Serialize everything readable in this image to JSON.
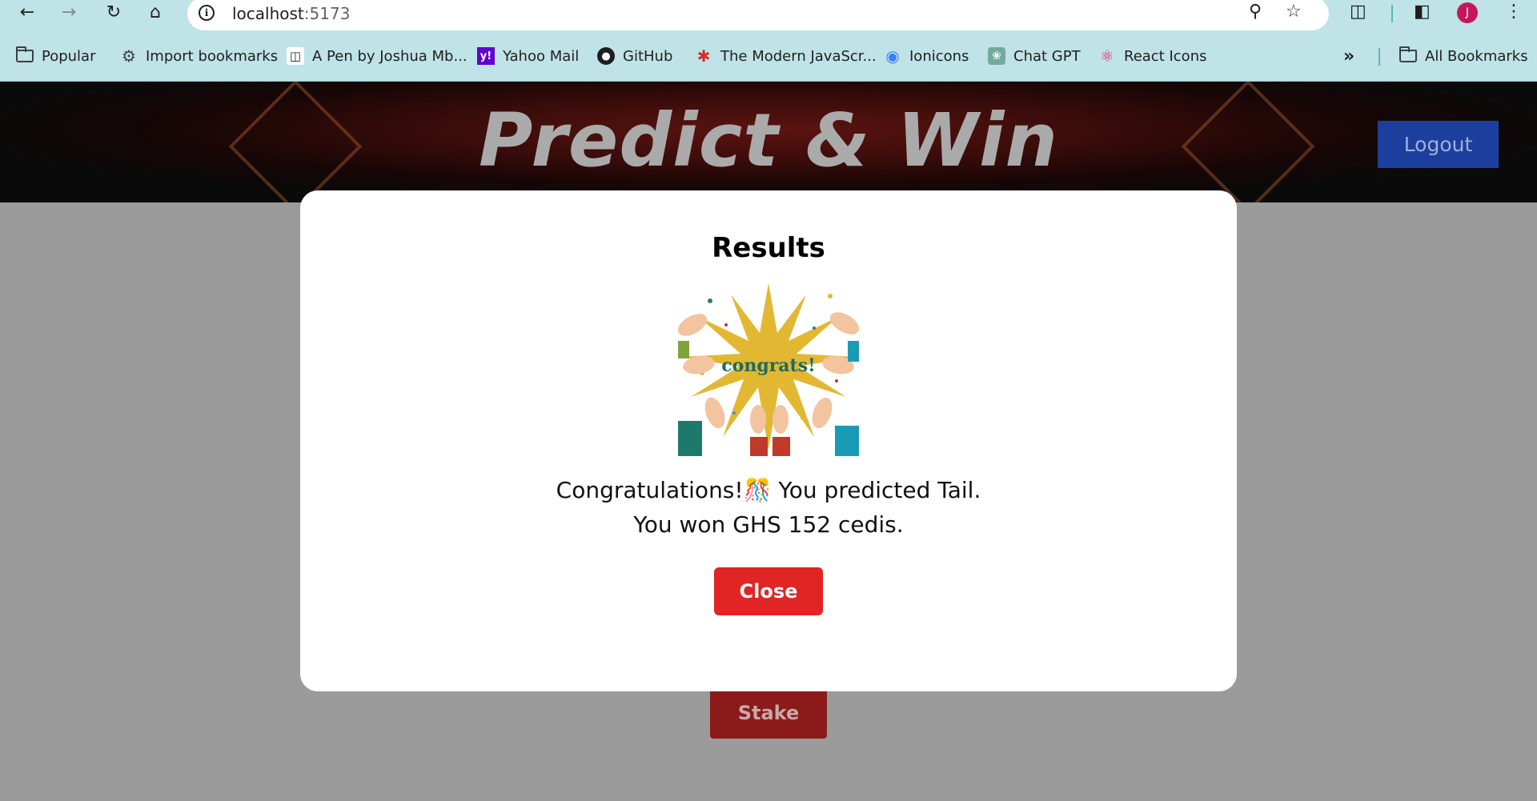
{
  "browser": {
    "url_host": "localhost",
    "url_port": ":5173",
    "bookmarks": [
      {
        "label": "Popular",
        "icon": "folder-icon"
      },
      {
        "label": "Import bookmarks",
        "icon": "gear-icon"
      },
      {
        "label": "A Pen by Joshua Mb...",
        "icon": "codepen-icon"
      },
      {
        "label": "Yahoo Mail",
        "icon": "yahoo-icon"
      },
      {
        "label": "GitHub",
        "icon": "github-icon"
      },
      {
        "label": "The Modern JavaScr...",
        "icon": "tower-icon"
      },
      {
        "label": "Ionicons",
        "icon": "ionicons-icon"
      },
      {
        "label": "Chat GPT",
        "icon": "openai-icon"
      },
      {
        "label": "React Icons",
        "icon": "react-icon"
      }
    ],
    "overflow_label": "»",
    "all_bookmarks": "All Bookmarks",
    "avatar_letter": "J"
  },
  "header": {
    "title": "Predict & Win",
    "logout_label": "Logout"
  },
  "main": {
    "stake_label": "Stake"
  },
  "modal": {
    "title": "Results",
    "image_text": "congrats!",
    "message_line1": "Congratulations!🎊  You predicted Tail.",
    "message_line2": "You won GHS 152 cedis.",
    "close_label": "Close"
  },
  "colors": {
    "chrome_bg": "#bfe3e6",
    "page_overlay": "#9b9b9b",
    "logout_bg": "#1c3f9e",
    "close_bg": "#e12424",
    "stake_bg": "#8c1a1a"
  }
}
